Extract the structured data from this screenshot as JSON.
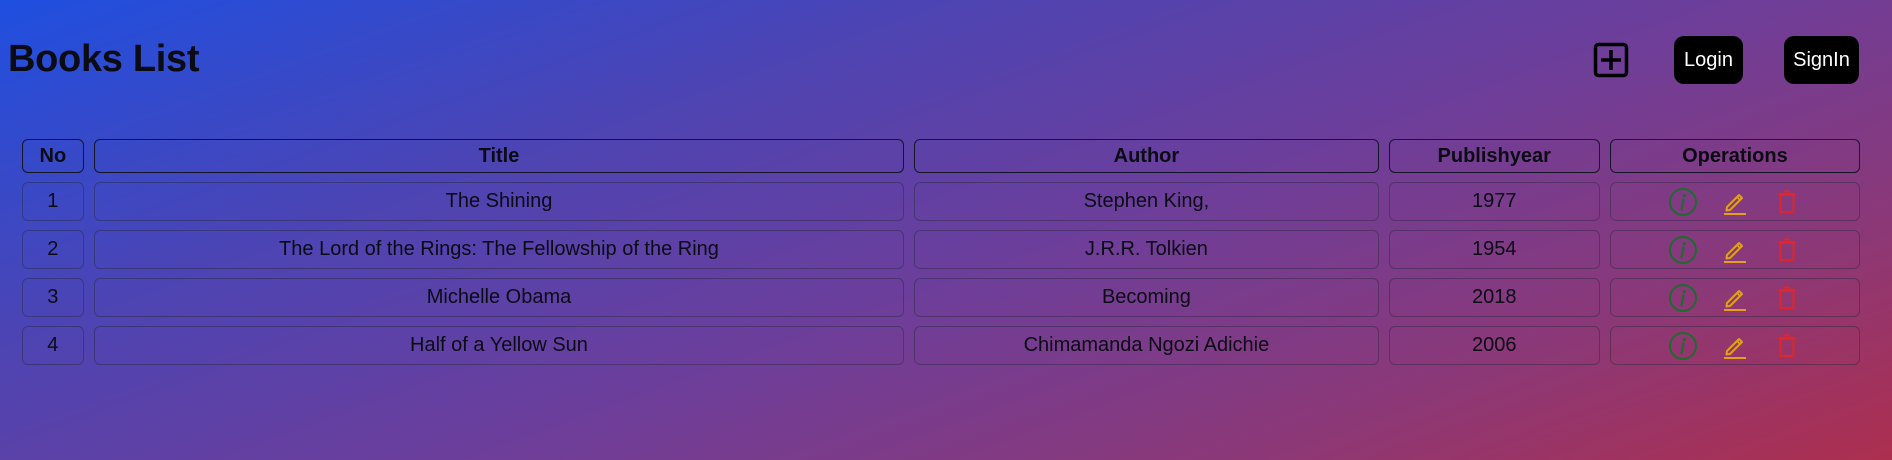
{
  "header": {
    "title": "Books List",
    "add_icon": "plus-square-icon",
    "login_label": "Login",
    "signin_label": "SignIn"
  },
  "table": {
    "columns": [
      "No",
      "Title",
      "Author",
      "Publishyear",
      "Operations"
    ],
    "rows": [
      {
        "no": "1",
        "title": "The Shining",
        "author": "Stephen King,",
        "year": "1977"
      },
      {
        "no": "2",
        "title": "The Lord of the Rings: The Fellowship of the Ring",
        "author": "J.R.R. Tolkien",
        "year": "1954"
      },
      {
        "no": "3",
        "title": "Michelle Obama",
        "author": "Becoming",
        "year": "2018"
      },
      {
        "no": "4",
        "title": "Half of a Yellow Sun",
        "author": "Chimamanda Ngozi Adichie",
        "year": "2006"
      }
    ],
    "operations": {
      "info_icon": "info-circle-icon",
      "edit_icon": "pencil-icon",
      "delete_icon": "trash-icon",
      "info_color": "#1e6b2e",
      "edit_color": "#e0a21a",
      "delete_color": "#e02626"
    }
  }
}
